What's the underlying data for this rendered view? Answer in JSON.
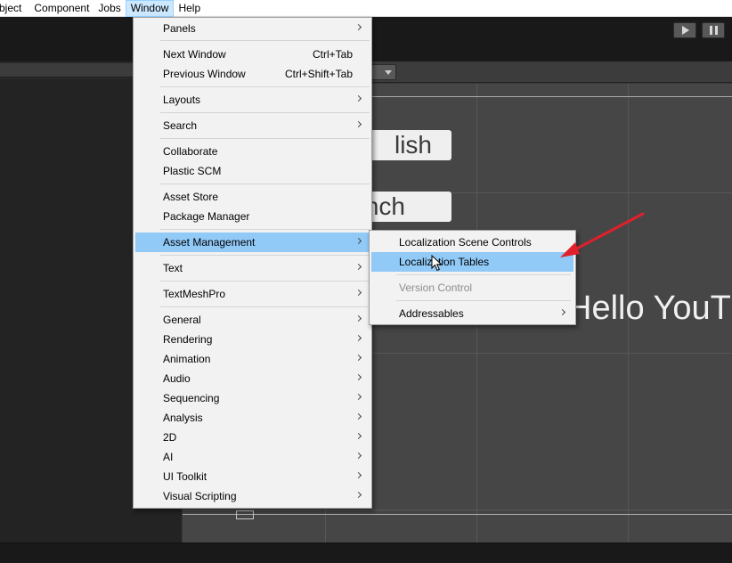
{
  "menubar": {
    "items": [
      "bject",
      "Component",
      "Jobs",
      "Window",
      "Help"
    ],
    "active": "Window"
  },
  "scene": {
    "button_english": "lish",
    "button_french": "nch",
    "hello_text": "Hello YouT"
  },
  "window_menu": {
    "items": [
      {
        "label": "Panels",
        "submenu": true
      },
      {
        "label": "Next Window",
        "shortcut": "Ctrl+Tab"
      },
      {
        "label": "Previous Window",
        "shortcut": "Ctrl+Shift+Tab"
      },
      {
        "label": "Layouts",
        "submenu": true
      },
      {
        "label": "Search",
        "submenu": true
      },
      {
        "label": "Collaborate"
      },
      {
        "label": "Plastic SCM"
      },
      {
        "label": "Asset Store"
      },
      {
        "label": "Package Manager"
      },
      {
        "label": "Asset Management",
        "submenu": true,
        "highlighted": true
      },
      {
        "label": "Text",
        "submenu": true
      },
      {
        "label": "TextMeshPro",
        "submenu": true
      },
      {
        "label": "General",
        "submenu": true
      },
      {
        "label": "Rendering",
        "submenu": true
      },
      {
        "label": "Animation",
        "submenu": true
      },
      {
        "label": "Audio",
        "submenu": true
      },
      {
        "label": "Sequencing",
        "submenu": true
      },
      {
        "label": "Analysis",
        "submenu": true
      },
      {
        "label": "2D",
        "submenu": true
      },
      {
        "label": "AI",
        "submenu": true
      },
      {
        "label": "UI Toolkit",
        "submenu": true
      },
      {
        "label": "Visual Scripting",
        "submenu": true
      }
    ]
  },
  "asset_management_submenu": {
    "items": [
      {
        "label": "Localization Scene Controls"
      },
      {
        "label": "Localization Tables",
        "highlighted": true
      },
      {
        "label": "Version Control",
        "disabled": true
      },
      {
        "label": "Addressables",
        "submenu": true
      }
    ]
  },
  "colors": {
    "menu_highlight": "#91c9f7",
    "menubar_active": "#cce8ff",
    "annotation_arrow": "#e0202a",
    "scene_background": "#464646"
  },
  "icons": {
    "play": "play-icon",
    "pause": "pause-icon",
    "submenu": "chevron-right-icon",
    "cursor": "mouse-cursor-icon",
    "annotation": "red-arrow-annotation"
  }
}
